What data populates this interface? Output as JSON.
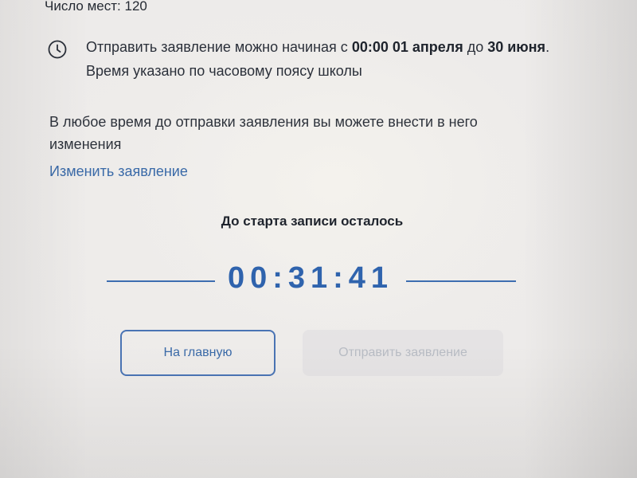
{
  "seats": {
    "text": "Число мест: 120"
  },
  "notice": {
    "icon": "clock-icon",
    "text_start": "Отправить заявление можно начиная с ",
    "start_datetime": "00:00 01 апреля",
    "text_until": " до ",
    "end_date": "30 июня",
    "text_end": ". Время указано по часовому поясу школы"
  },
  "info": {
    "text": "В любое время до отправки заявления вы можете внести в него изменения"
  },
  "edit_link": {
    "label": "Изменить заявление"
  },
  "countdown": {
    "title": "До старта записи осталось",
    "time": "00:31:41"
  },
  "buttons": {
    "home_label": "На главную",
    "submit_label": "Отправить заявление"
  },
  "colors": {
    "accent": "#2f63ad",
    "link": "#3a6aa8",
    "disabled_text": "#b8bcc4"
  }
}
